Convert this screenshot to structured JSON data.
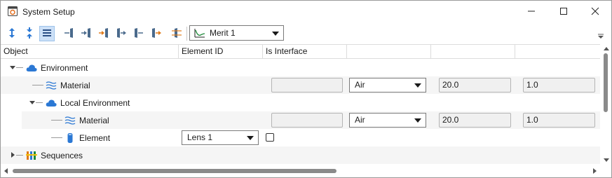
{
  "window": {
    "title": "System Setup",
    "app_icon": "system-setup-icon"
  },
  "titlebar_controls": {
    "minimize": "minimize-icon",
    "maximize": "maximize-icon",
    "close": "close-icon"
  },
  "toolbar": {
    "buttons": [
      "expand-vertical-icon",
      "collapse-vertical-icon",
      "list-view-icon",
      "insert-surface-before-icon",
      "insert-surface-icon",
      "insert-surface-after-icon",
      "add-element-right-icon",
      "add-element-icon",
      "add-element-after-icon",
      "element-settings-icon"
    ],
    "merit_combo": {
      "icon": "merit-chart-icon",
      "value": "Merit 1"
    },
    "overflow": "overflow-caret-icon"
  },
  "columns": [
    "Object",
    "Element ID",
    "Is Interface",
    "",
    "",
    ""
  ],
  "tree": [
    {
      "label": "Environment",
      "icon": "cloud-icon",
      "expanded": true
    },
    {
      "label": "Material",
      "icon": "material-waves-icon",
      "medium": "Air",
      "temperature": "20.0",
      "pressure": "1.0"
    },
    {
      "label": "Local Environment",
      "icon": "cloud-icon",
      "expanded": true
    },
    {
      "label": "Material",
      "icon": "material-waves-icon",
      "medium": "Air",
      "temperature": "20.0",
      "pressure": "1.0"
    },
    {
      "label": "Element",
      "icon": "lens-element-icon",
      "element_id": "Lens 1",
      "is_interface": false
    },
    {
      "label": "Sequences",
      "icon": "sequences-icon",
      "expanded": false
    }
  ],
  "colors": {
    "accent": "#2b78d4",
    "header_bg": "#ffffff",
    "row_alt": "#f5f5f5"
  }
}
